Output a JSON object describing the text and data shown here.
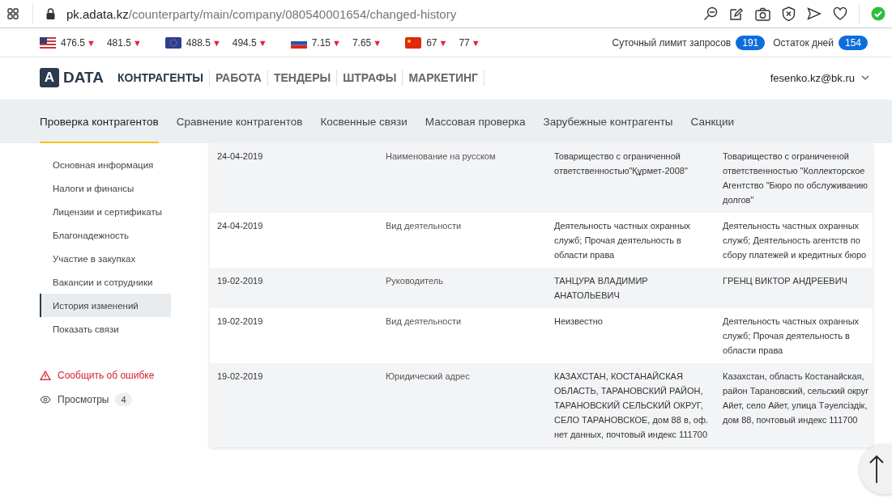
{
  "browser": {
    "url_host": "pk.adata.kz",
    "url_path": "/counterparty/main/company/080540001654/changed-history"
  },
  "rates": [
    {
      "kind": "usd",
      "buy": "476.5",
      "buy_arrow": "▼",
      "sell": "481.5",
      "sell_arrow": "▼"
    },
    {
      "kind": "eur",
      "buy": "488.5",
      "buy_arrow": "▼",
      "sell": "494.5",
      "sell_arrow": "▼"
    },
    {
      "kind": "rub",
      "buy": "7.15",
      "buy_arrow": "▼",
      "sell": "7.65",
      "sell_arrow": "▼"
    },
    {
      "kind": "cny",
      "buy": "67",
      "buy_arrow": "▼",
      "sell": "77",
      "sell_arrow": "▼"
    }
  ],
  "limits": [
    {
      "label": "Суточный лимит запросов",
      "count": "191"
    },
    {
      "label": "Остаток дней",
      "count": "154"
    }
  ],
  "logo": {
    "mark": "A",
    "text": "DATA"
  },
  "main_nav": [
    {
      "label": "КОНТРАГЕНТЫ",
      "selected": true
    },
    {
      "label": "РАБОТА",
      "selected": false
    },
    {
      "label": "ТЕНДЕРЫ",
      "selected": false
    },
    {
      "label": "ШТРАФЫ",
      "selected": false
    },
    {
      "label": "МАРКЕТИНГ",
      "selected": false
    }
  ],
  "user": {
    "email": "fesenko.kz@bk.ru"
  },
  "sub_nav": [
    {
      "label": "Проверка контрагентов",
      "selected": true
    },
    {
      "label": "Сравнение контрагентов",
      "selected": false
    },
    {
      "label": "Косвенные связи",
      "selected": false
    },
    {
      "label": "Массовая проверка",
      "selected": false
    },
    {
      "label": "Зарубежные контрагенты",
      "selected": false
    },
    {
      "label": "Санкции",
      "selected": false
    }
  ],
  "sidebar": {
    "items": [
      {
        "label": "Основная информация",
        "selected": false
      },
      {
        "label": "Налоги и финансы",
        "selected": false
      },
      {
        "label": "Лицензии и сертификаты",
        "selected": false
      },
      {
        "label": "Благонадежность",
        "selected": false
      },
      {
        "label": "Участие в закупках",
        "selected": false
      },
      {
        "label": "Вакансии и сотрудники",
        "selected": false
      },
      {
        "label": "История изменений",
        "selected": true
      },
      {
        "label": "Показать связи",
        "selected": false
      }
    ],
    "report_link": "Сообщить об ошибке",
    "views": {
      "label": "Просмотры",
      "count": "4"
    }
  },
  "history": {
    "rows": [
      {
        "cells": [
          "24-04-2019",
          "Наименование на русском",
          "Товарищество с ограниченной ответственностью\"Құрмет-2008\"",
          "Товарищество с ограниченной ответственностью \"Коллекторское Агентство \"Бюро по обслуживанию долгов\""
        ]
      },
      {
        "cells": [
          "24-04-2019",
          "Вид деятельности",
          "Деятельность частных охранных служб; Прочая деятельность в области права",
          "Деятельность частных охранных служб; Деятельность агентств по сбору платежей и кредитных бюро"
        ]
      },
      {
        "cells": [
          "19-02-2019",
          "Руководитель",
          "ТАНЦУРА ВЛАДИМИР АНАТОЛЬЕВИЧ",
          "ГРЕНЦ ВИКТОР АНДРЕЕВИЧ"
        ]
      },
      {
        "cells": [
          "19-02-2019",
          "Вид деятельности",
          "Неизвестно",
          "Деятельность частных охранных служб; Прочая деятельность в области права"
        ]
      },
      {
        "cells": [
          "19-02-2019",
          "Юридический адрес",
          "КАЗАХСТАН, КОСТАНАЙСКАЯ ОБЛАСТЬ, ТАРАНОВСКИЙ РАЙОН, ТАРАНОВСКИЙ СЕЛЬСКИЙ ОКРУГ, СЕЛО ТАРАНОВСКОЕ, дом 88 в, оф. нет данных, почтовый индекс 111700",
          "Казахстан, область Костанайская, район Тарановский, сельский округ Айет, село Айет, улица Тәуелсіздік, дом 88, почтовый индекс 111700"
        ]
      }
    ]
  }
}
